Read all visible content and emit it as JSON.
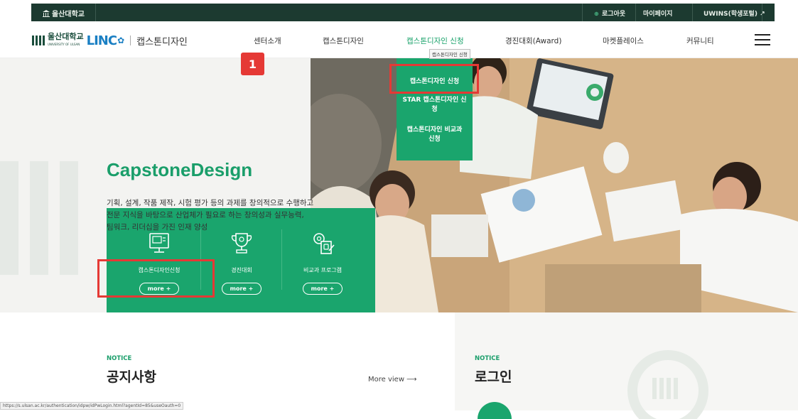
{
  "topbar": {
    "university": "울산대학교",
    "logout": "로그아웃",
    "mypage": "마이페이지",
    "portal": "UWINS(학생포털)"
  },
  "header": {
    "logo_korean": "울산대학교",
    "logo_english": "UNIVERSITY OF ULSAN",
    "logo_linc": "LINC",
    "logo_site": "캡스톤디자인",
    "nav": [
      "센터소개",
      "캡스톤디자인",
      "캡스톤디자인 신청",
      "경진대회(Award)",
      "마켓플레이스",
      "커뮤니티"
    ],
    "tooltip": "캡스톤디자인 신청"
  },
  "step_badge": "1",
  "hero": {
    "title": "CapstoneDesign",
    "desc_lines": [
      "기획, 설계, 작품 제작, 시험 평가 등의 과제를 창의적으로 수행하고",
      "전문 지식을 바탕으로 산업체가 필요로 하는 창의성과 실무능력,",
      "팀워크, 리더십을 가진 인재 양성"
    ]
  },
  "dropdown": {
    "items": [
      "캡스톤디자인 신청",
      "STAR 캡스톤디자인 신청",
      "캡스톤디자인 비교과 신청"
    ]
  },
  "cards": [
    {
      "label": "캡스톤디자인신청",
      "more": "more +",
      "icon": "monitor-icon"
    },
    {
      "label": "경진대회",
      "more": "more +",
      "icon": "trophy-icon"
    },
    {
      "label": "비교과 프로그램",
      "more": "more +",
      "icon": "gear-document-icon"
    }
  ],
  "slider": {
    "prev": "⟵",
    "next": "⟶",
    "pause": "II"
  },
  "notice": {
    "eyebrow": "NOTICE",
    "title": "공지사항",
    "more_view": "More view ⟶"
  },
  "login": {
    "eyebrow": "NOTICE",
    "title": "로그인"
  },
  "status_url": "https://s.ulsan.ac.kr/authentication/idpw/idPwLogin.html?agentId=85&useOauth=0",
  "colors": {
    "brand_green": "#1aa56d",
    "dark_top": "#1c3a30",
    "highlight": "#e53935"
  }
}
